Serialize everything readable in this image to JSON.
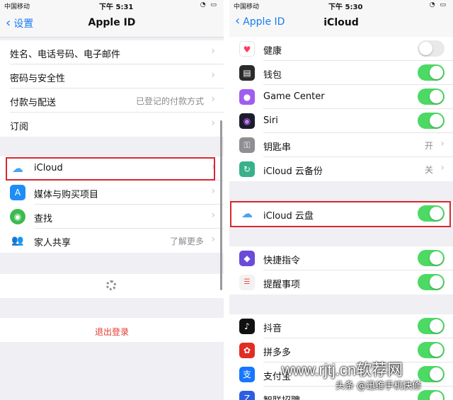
{
  "left": {
    "status": {
      "carrier": "中国移动",
      "time": "下午 5:31"
    },
    "nav": {
      "back_label": "设置",
      "title": "Apple ID"
    },
    "group1": [
      {
        "label": "姓名、电话号码、电子邮件",
        "value": ""
      },
      {
        "label": "密码与安全性",
        "value": ""
      },
      {
        "label": "付款与配送",
        "value": "已登记的付款方式"
      },
      {
        "label": "订阅",
        "value": ""
      }
    ],
    "group2": [
      {
        "label": "iCloud",
        "value": "",
        "icon": "cloud-icon",
        "color": "#4aa3f0"
      },
      {
        "label": "媒体与购买项目",
        "value": "",
        "icon": "app-store-icon",
        "color": "#1e8ef5"
      },
      {
        "label": "查找",
        "value": "",
        "icon": "find-my-icon",
        "color": "#3dbb4f"
      },
      {
        "label": "家人共享",
        "value": "了解更多",
        "icon": "family-icon",
        "color": "#5aa9e6"
      }
    ],
    "signout_label": "退出登录"
  },
  "right": {
    "status": {
      "carrier": "中国移动",
      "time": "下午 5:30"
    },
    "nav": {
      "back_label": "Apple ID",
      "title": "iCloud"
    },
    "group1": [
      {
        "label": "健康",
        "kind": "toggle",
        "on": false,
        "icon": "health-icon",
        "color": "#ffffff"
      },
      {
        "label": "钱包",
        "kind": "toggle",
        "on": true,
        "icon": "wallet-icon",
        "color": "#2b2b2b"
      },
      {
        "label": "Game Center",
        "kind": "toggle",
        "on": true,
        "icon": "game-center-icon",
        "color": "#a25cf0"
      },
      {
        "label": "Siri",
        "kind": "toggle",
        "on": true,
        "icon": "siri-icon",
        "color": "#1c1c2e"
      },
      {
        "label": "钥匙串",
        "kind": "value",
        "value": "开",
        "icon": "keychain-icon",
        "color": "#8e8e93"
      },
      {
        "label": "iCloud 云备份",
        "kind": "value",
        "value": "关",
        "icon": "backup-icon",
        "color": "#38b08a"
      }
    ],
    "drive": {
      "label": "iCloud 云盘",
      "on": true,
      "icon": "cloud-icon",
      "color": "#4aa3f0"
    },
    "group2": [
      {
        "label": "快捷指令",
        "on": true,
        "icon": "shortcuts-icon",
        "color": "#6a4cd8"
      },
      {
        "label": "提醒事项",
        "on": true,
        "icon": "reminders-icon",
        "color": "#f2f2f2"
      }
    ],
    "group3": [
      {
        "label": "抖音",
        "on": true,
        "icon": "douyin-icon",
        "color": "#111111"
      },
      {
        "label": "拼多多",
        "on": true,
        "icon": "pinduoduo-icon",
        "color": "#e02e24"
      },
      {
        "label": "支付宝",
        "on": true,
        "icon": "alipay-icon",
        "color": "#1677ff"
      },
      {
        "label": "智联招聘",
        "on": true,
        "icon": "zhaopin-icon",
        "color": "#2c5fe0"
      }
    ]
  },
  "watermark": {
    "site": "www.rjtj.cn软荐网",
    "credit": "头条 @迅维手机快修"
  }
}
